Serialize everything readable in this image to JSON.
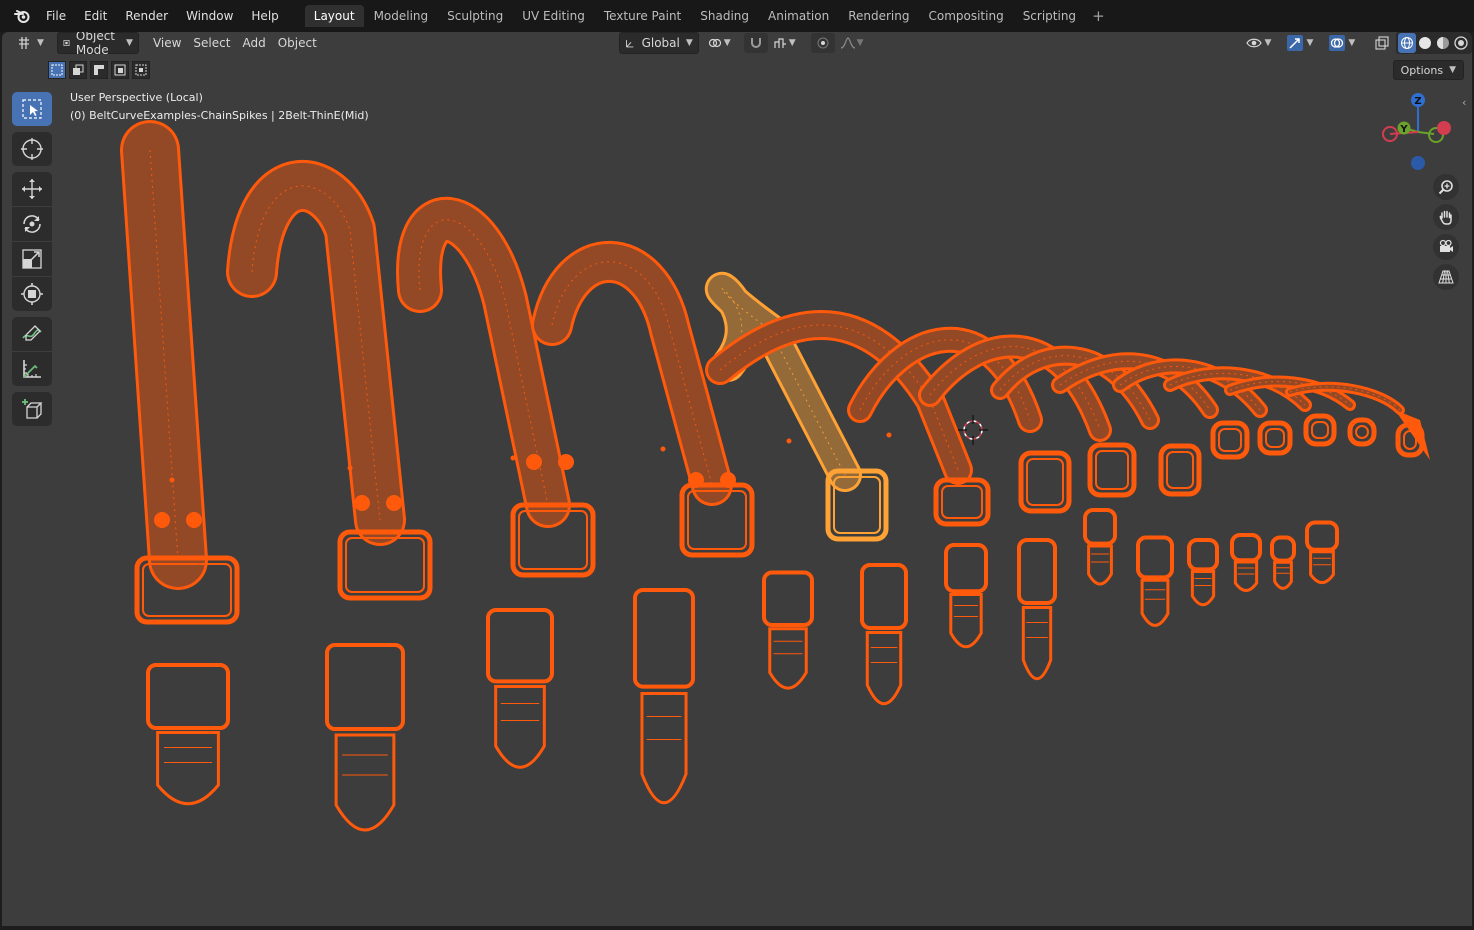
{
  "topbar": {
    "menus": [
      "File",
      "Edit",
      "Render",
      "Window",
      "Help"
    ],
    "workspaces": [
      "Layout",
      "Modeling",
      "Sculpting",
      "UV Editing",
      "Texture Paint",
      "Shading",
      "Animation",
      "Rendering",
      "Compositing",
      "Scripting"
    ],
    "active_workspace": "Layout"
  },
  "header": {
    "mode": "Object Mode",
    "menus": [
      "View",
      "Select",
      "Add",
      "Object"
    ],
    "orientation": "Global",
    "options_label": "Options"
  },
  "viewport": {
    "perspective": "User Perspective (Local)",
    "object_info": "(0) BeltCurveExamples-ChainSpikes | 2Belt-ThinE(Mid)"
  },
  "gizmo": {
    "z": "Z",
    "y": "Y"
  },
  "colors": {
    "accent": "#4772b3",
    "wire_selected": "#ff5a0c",
    "wire_active": "#ffa235",
    "viewport_bg": "#3d3d3d"
  }
}
